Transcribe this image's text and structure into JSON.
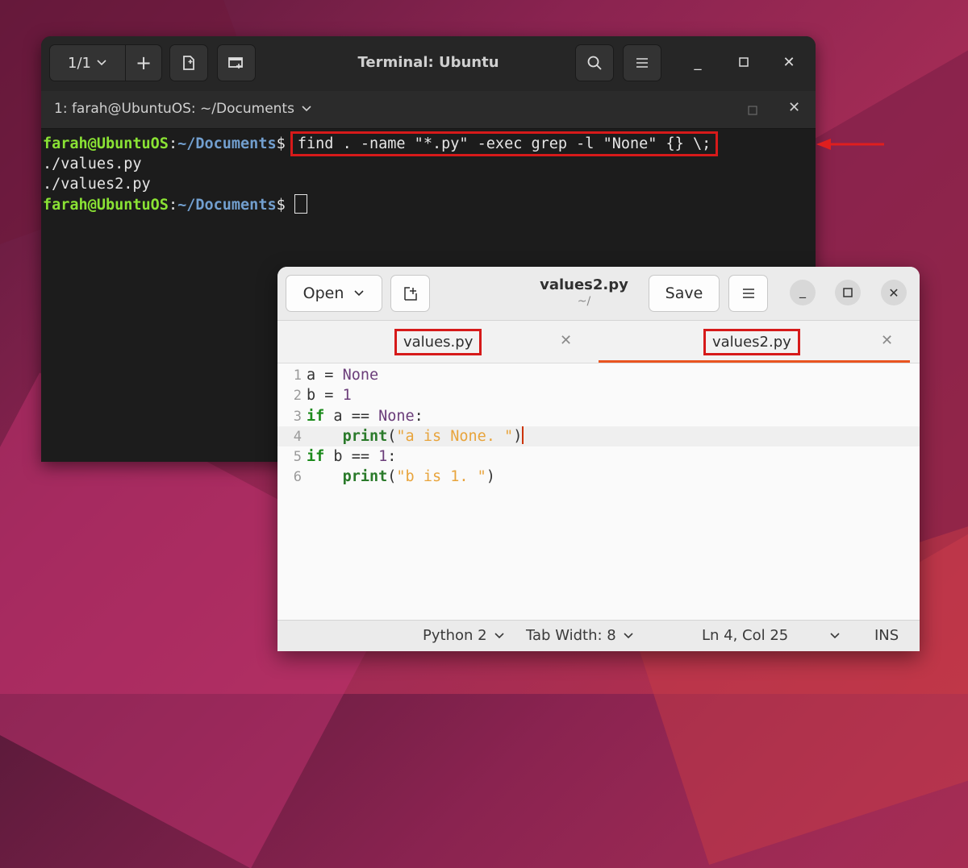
{
  "terminal": {
    "title": "Terminal: Ubuntu",
    "tab_counter": "1/1",
    "tab_title": "1: farah@UbuntuOS: ~/Documents",
    "prompt_user": "farah@UbuntuOS",
    "prompt_colon": ":",
    "prompt_path": "~/Documents",
    "prompt_symbol": "$",
    "command": "find . -name \"*.py\" -exec grep -l \"None\" {} \\;",
    "output": [
      "./values.py",
      "./values2.py"
    ],
    "icons": [
      "chevron-down-icon",
      "plus-icon",
      "new-tab-icon",
      "new-window-icon",
      "search-icon",
      "menu-icon",
      "minimize-icon",
      "maximize-icon",
      "close-icon"
    ]
  },
  "editor": {
    "open_label": "Open",
    "file_name": "values2.py",
    "file_dir": "~/",
    "save_label": "Save",
    "tabs": [
      {
        "label": "values.py",
        "active": false
      },
      {
        "label": "values2.py",
        "active": true
      }
    ],
    "code": [
      {
        "num": "1",
        "parts": [
          [
            "txt",
            "a "
          ],
          [
            "txt",
            "= "
          ],
          [
            "cst",
            "None"
          ]
        ]
      },
      {
        "num": "2",
        "parts": [
          [
            "txt",
            "b "
          ],
          [
            "txt",
            "= "
          ],
          [
            "cst",
            "1"
          ]
        ]
      },
      {
        "num": "3",
        "parts": [
          [
            "kw",
            "if"
          ],
          [
            "txt",
            " a == "
          ],
          [
            "cst",
            "None"
          ],
          [
            "txt",
            ":"
          ]
        ]
      },
      {
        "num": "4",
        "parts": [
          [
            "txt",
            "    "
          ],
          [
            "fnc",
            "print"
          ],
          [
            "txt",
            "("
          ],
          [
            "str",
            "\"a is None. \""
          ],
          [
            "txt",
            ")"
          ]
        ]
      },
      {
        "num": "5",
        "parts": [
          [
            "kw",
            "if"
          ],
          [
            "txt",
            " b == "
          ],
          [
            "cst",
            "1"
          ],
          [
            "txt",
            ":"
          ]
        ]
      },
      {
        "num": "6",
        "parts": [
          [
            "txt",
            "    "
          ],
          [
            "fnc",
            "print"
          ],
          [
            "txt",
            "("
          ],
          [
            "str",
            "\"b is 1. \""
          ],
          [
            "txt",
            ")"
          ]
        ]
      }
    ],
    "current_line": 4,
    "status": {
      "language": "Python 2",
      "tab_width": "Tab Width: 8",
      "position": "Ln 4, Col 25",
      "mode": "INS"
    }
  },
  "colors": {
    "highlight": "#d61a1a",
    "accent": "#e95420",
    "prompt_user": "#8ae234",
    "prompt_path": "#729fcf"
  }
}
